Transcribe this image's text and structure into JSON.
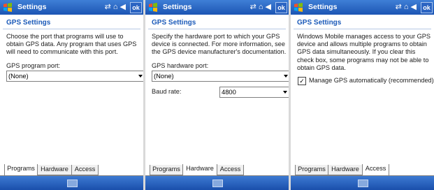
{
  "panels": [
    {
      "title": "Settings",
      "ok_label": "ok",
      "page_heading": "GPS Settings",
      "description": "Choose the port that programs will use to obtain GPS data. Any program that uses GPS will need to communicate with this port.",
      "field_label": "GPS program port:",
      "field_value": "(None)",
      "tabs": [
        "Programs",
        "Hardware",
        "Access"
      ],
      "active_tab": "Programs"
    },
    {
      "title": "Settings",
      "ok_label": "ok",
      "page_heading": "GPS Settings",
      "description": "Specify the hardware port to which your GPS device is connected. For more information, see the GPS device manufacturer's documentation.",
      "field_label": "GPS hardware port:",
      "field_value": "(None)",
      "baud_label": "Baud rate:",
      "baud_value": "4800",
      "tabs": [
        "Programs",
        "Hardware",
        "Access"
      ],
      "active_tab": "Hardware"
    },
    {
      "title": "Settings",
      "ok_label": "ok",
      "page_heading": "GPS Settings",
      "description": "Windows Mobile manages access to your GPS device and allows multiple programs to obtain GPS data simultaneously. If you clear this check box, some programs may not be able to obtain GPS data.",
      "checkbox_label": "Manage GPS automatically (recommended)",
      "checkbox_checked": true,
      "tabs": [
        "Programs",
        "Hardware",
        "Access"
      ],
      "active_tab": "Access"
    }
  ],
  "status_icons": [
    "connectivity-icon",
    "signal-icon",
    "volume-icon"
  ],
  "checkmark_glyph": "✓",
  "colors": {
    "titlebar": "#2a67c8",
    "heading": "#1b5ab9",
    "bottombar": "#2a63c0"
  }
}
